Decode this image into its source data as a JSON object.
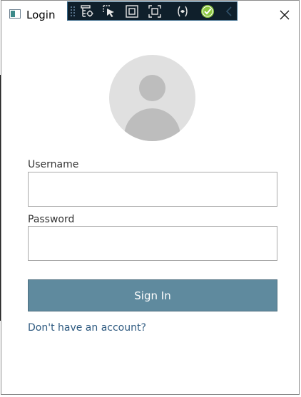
{
  "window": {
    "title": "Login",
    "icons": {
      "app": "window-app-icon",
      "close": "close-icon"
    }
  },
  "debug_toolbar": {
    "tools": [
      {
        "name": "go-to-live-visual-tree-icon"
      },
      {
        "name": "select-element-icon"
      },
      {
        "name": "display-layout-adorners-icon"
      },
      {
        "name": "track-focused-element-icon"
      },
      {
        "name": "binding-failures-icon"
      },
      {
        "name": "hot-reload-check-icon"
      },
      {
        "name": "collapse-toolbar-icon"
      }
    ]
  },
  "avatar": {
    "icon": "user-placeholder-icon"
  },
  "form": {
    "username_label": "Username",
    "username_value": "",
    "password_label": "Password",
    "password_value": "",
    "signin_label": "Sign In",
    "signup_link": "Don't have an account?"
  },
  "colors": {
    "accent": "#5f8a9e",
    "link": "#2e5a80",
    "toolbar_bg": "#0f1f2b",
    "check_green": "#8cc63f"
  }
}
